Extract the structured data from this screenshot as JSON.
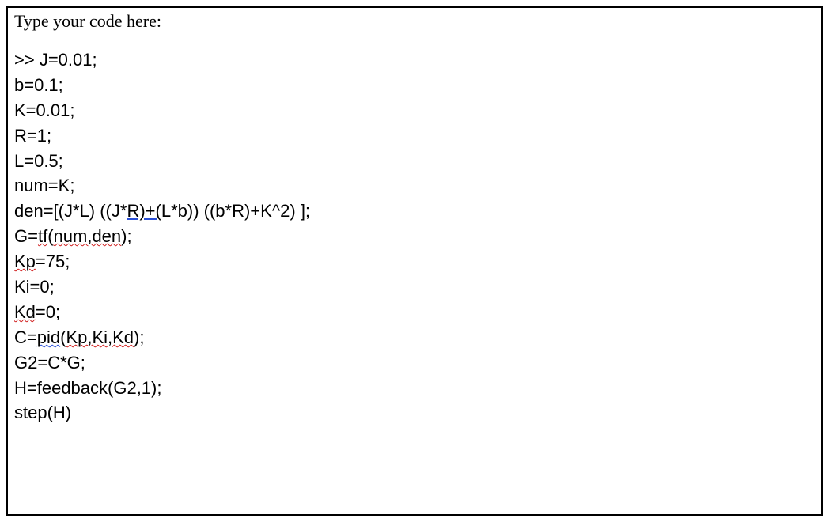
{
  "editor": {
    "placeholder": "Type your code here:",
    "prompt": ">> ",
    "lines": {
      "l1a": ">> ",
      "l1b": "J=0.01;",
      "l2": "b=0.1;",
      "l3": "K=0.01;",
      "l4": "R=1;",
      "l5": "L=0.5;",
      "l6": "num=K;",
      "l7a": "den=[(J*L) ((J*",
      "l7b": "R)+(",
      "l7c": "L*b)) ((b*R)+K^2) ];",
      "l8a": "G=",
      "l8b": "tf",
      "l8c": "(",
      "l8d": "num,den",
      "l8e": ");",
      "l9a": "Kp",
      "l9b": "=75;",
      "l10": "Ki=0;",
      "l11a": "Kd",
      "l11b": "=0;",
      "l12a": "C=",
      "l12b": "pid",
      "l12c": "(",
      "l12d": "Kp,Ki,Kd",
      "l12e": ");",
      "l13": "G2=C*G;",
      "l14": "H=feedback(G2,1);",
      "l15": "step(H)"
    }
  }
}
